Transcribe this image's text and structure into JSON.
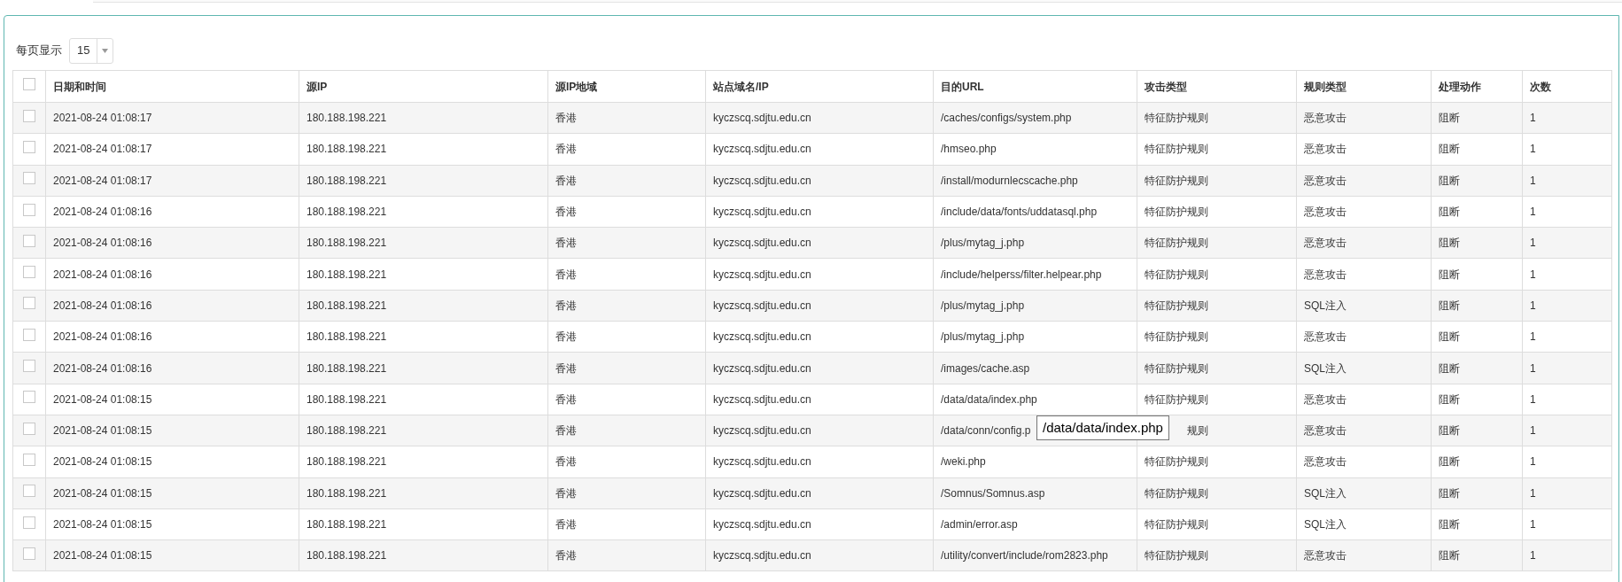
{
  "page_size": {
    "label": "每页显示",
    "value": "15"
  },
  "table": {
    "header_checkbox": {
      "checked": false
    },
    "columns": [
      "日期和时间",
      "源IP",
      "源IP地域",
      "站点域名/IP",
      "目的URL",
      "攻击类型",
      "规则类型",
      "处理动作",
      "次数"
    ],
    "rows": [
      {
        "checked": false,
        "cells": [
          "2021-08-24 01:08:17",
          "180.188.198.221",
          "香港",
          "kyczscq.sdjtu.edu.cn",
          "/caches/configs/system.php",
          "特征防护规则",
          "恶意攻击",
          "阻断",
          "1"
        ]
      },
      {
        "checked": false,
        "cells": [
          "2021-08-24 01:08:17",
          "180.188.198.221",
          "香港",
          "kyczscq.sdjtu.edu.cn",
          "/hmseo.php",
          "特征防护规则",
          "恶意攻击",
          "阻断",
          "1"
        ]
      },
      {
        "checked": false,
        "cells": [
          "2021-08-24 01:08:17",
          "180.188.198.221",
          "香港",
          "kyczscq.sdjtu.edu.cn",
          "/install/modurnlecscache.php",
          "特征防护规则",
          "恶意攻击",
          "阻断",
          "1"
        ]
      },
      {
        "checked": false,
        "cells": [
          "2021-08-24 01:08:16",
          "180.188.198.221",
          "香港",
          "kyczscq.sdjtu.edu.cn",
          "/include/data/fonts/uddatasql.php",
          "特征防护规则",
          "恶意攻击",
          "阻断",
          "1"
        ]
      },
      {
        "checked": false,
        "cells": [
          "2021-08-24 01:08:16",
          "180.188.198.221",
          "香港",
          "kyczscq.sdjtu.edu.cn",
          "/plus/mytag_j.php",
          "特征防护规则",
          "恶意攻击",
          "阻断",
          "1"
        ]
      },
      {
        "checked": false,
        "cells": [
          "2021-08-24 01:08:16",
          "180.188.198.221",
          "香港",
          "kyczscq.sdjtu.edu.cn",
          "/include/helperss/filter.helpear.php",
          "特征防护规则",
          "恶意攻击",
          "阻断",
          "1"
        ]
      },
      {
        "checked": false,
        "cells": [
          "2021-08-24 01:08:16",
          "180.188.198.221",
          "香港",
          "kyczscq.sdjtu.edu.cn",
          "/plus/mytag_j.php",
          "特征防护规则",
          "SQL注入",
          "阻断",
          "1"
        ]
      },
      {
        "checked": false,
        "cells": [
          "2021-08-24 01:08:16",
          "180.188.198.221",
          "香港",
          "kyczscq.sdjtu.edu.cn",
          "/plus/mytag_j.php",
          "特征防护规则",
          "恶意攻击",
          "阻断",
          "1"
        ]
      },
      {
        "checked": false,
        "cells": [
          "2021-08-24 01:08:16",
          "180.188.198.221",
          "香港",
          "kyczscq.sdjtu.edu.cn",
          "/images/cache.asp",
          "特征防护规则",
          "SQL注入",
          "阻断",
          "1"
        ]
      },
      {
        "checked": false,
        "cells": [
          "2021-08-24 01:08:15",
          "180.188.198.221",
          "香港",
          "kyczscq.sdjtu.edu.cn",
          "/data/data/index.php",
          "特征防护规则",
          "恶意攻击",
          "阻断",
          "1"
        ]
      },
      {
        "checked": false,
        "cells": [
          "2021-08-24 01:08:15",
          "180.188.198.221",
          "香港",
          "kyczscq.sdjtu.edu.cn",
          "/data/conn/config.p",
          "规则",
          "恶意攻击",
          "阻断",
          "1"
        ],
        "tooltip": "/data/data/index.php"
      },
      {
        "checked": false,
        "cells": [
          "2021-08-24 01:08:15",
          "180.188.198.221",
          "香港",
          "kyczscq.sdjtu.edu.cn",
          "/weki.php",
          "特征防护规则",
          "恶意攻击",
          "阻断",
          "1"
        ]
      },
      {
        "checked": false,
        "cells": [
          "2021-08-24 01:08:15",
          "180.188.198.221",
          "香港",
          "kyczscq.sdjtu.edu.cn",
          "/Somnus/Somnus.asp",
          "特征防护规则",
          "SQL注入",
          "阻断",
          "1"
        ]
      },
      {
        "checked": false,
        "cells": [
          "2021-08-24 01:08:15",
          "180.188.198.221",
          "香港",
          "kyczscq.sdjtu.edu.cn",
          "/admin/error.asp",
          "特征防护规则",
          "SQL注入",
          "阻断",
          "1"
        ]
      },
      {
        "checked": false,
        "cells": [
          "2021-08-24 01:08:15",
          "180.188.198.221",
          "香港",
          "kyczscq.sdjtu.edu.cn",
          "/utility/convert/include/rom2823.php",
          "特征防护规则",
          "恶意攻击",
          "阻断",
          "1"
        ]
      }
    ]
  }
}
